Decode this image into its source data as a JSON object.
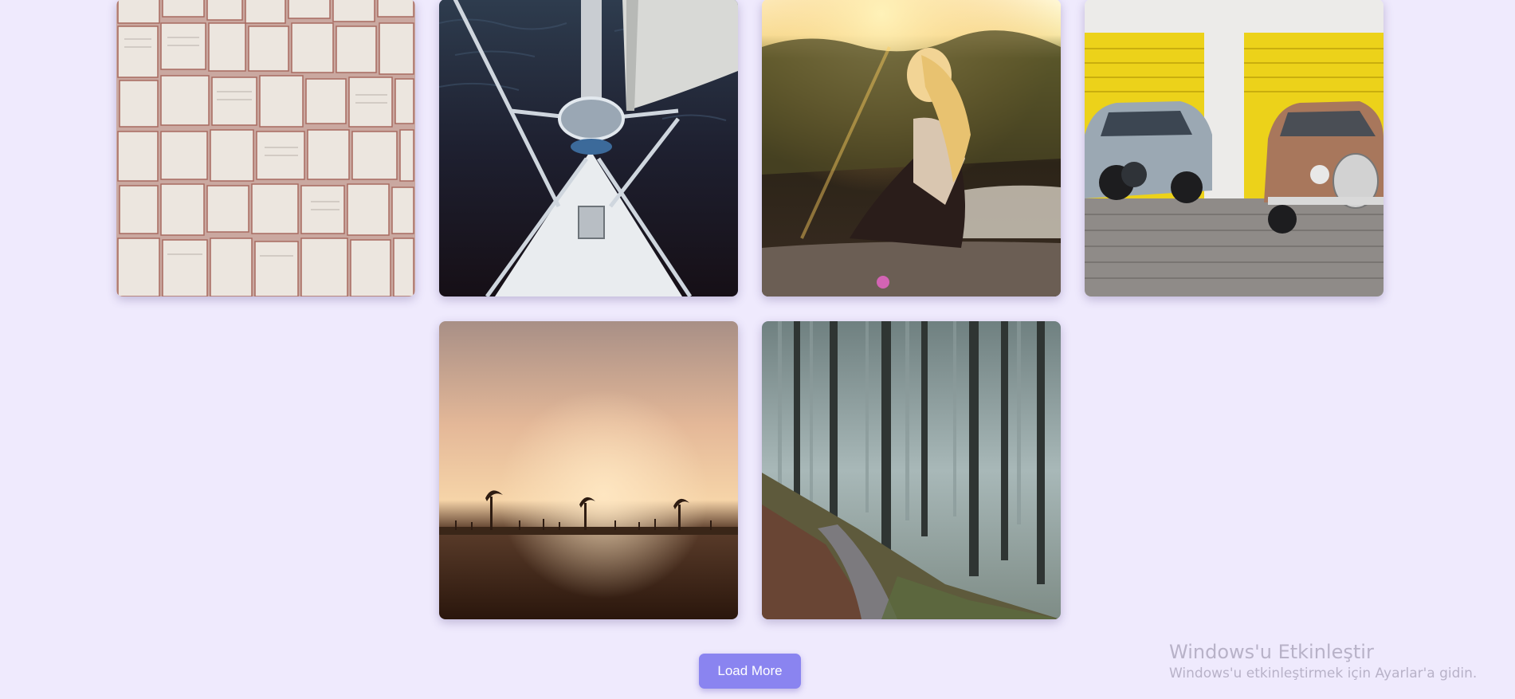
{
  "gallery": {
    "photos": [
      {
        "subject": "open books spread flat"
      },
      {
        "subject": "sailboat bow over dark water"
      },
      {
        "subject": "woman sitting on rock at sunset"
      },
      {
        "subject": "two vintage cars in front of yellow garage doors"
      },
      {
        "subject": "palm trees silhouetted at dusk"
      },
      {
        "subject": "misty forest path"
      }
    ]
  },
  "actions": {
    "load_more_label": "Load More"
  },
  "watermark": {
    "title": "Windows'u Etkinleştir",
    "subtitle": "Windows'u etkinleştirmek için Ayarlar'a gidin."
  },
  "colors": {
    "page_background": "#efeafd",
    "button_background": "#8a84f0",
    "button_text": "#ffffff"
  }
}
